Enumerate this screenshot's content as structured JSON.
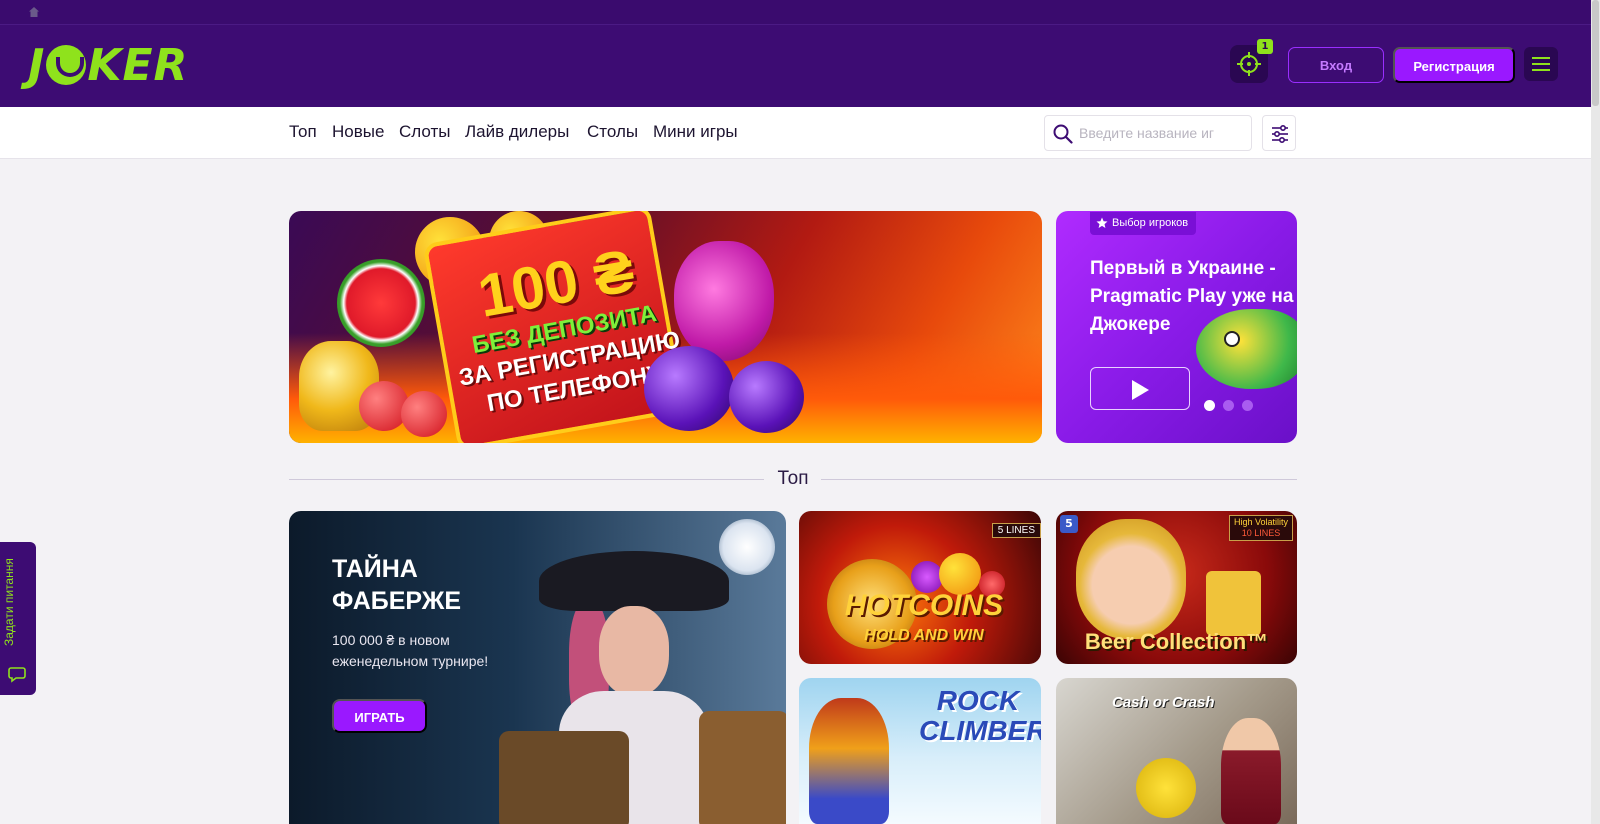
{
  "topbar": {
    "home_icon": "home-icon"
  },
  "header": {
    "logo_text_a": "J",
    "logo_text_b": "KER",
    "notification_count": "1",
    "login_label": "Вход",
    "register_label": "Регистрация",
    "menu_icon": "hamburger-menu-icon",
    "target_icon": "crosshair-icon",
    "brand_color": "#8fe21c",
    "header_bg": "#3d0c73",
    "accent": "#9a18ff"
  },
  "nav": {
    "items": [
      {
        "label": "Топ"
      },
      {
        "label": "Новые"
      },
      {
        "label": "Слоты"
      },
      {
        "label": "Лайв дилеры"
      },
      {
        "label": "Столы"
      },
      {
        "label": "Мини игры"
      }
    ],
    "search_placeholder": "Введите название иг",
    "filter_icon": "sliders-icon"
  },
  "banner_main": {
    "amount": "100 ₴",
    "line1": "БЕЗ ДЕПОЗИТА",
    "line2": "ЗА РЕГИСТРАЦИЮ",
    "line3": "ПО ТЕЛЕФОНУ"
  },
  "banner_side": {
    "badge": "Выбор игроков",
    "title": "Первый в Украине - Pragmatic Play уже на Джокере",
    "slide_count": 3,
    "active_slide": 1
  },
  "section": {
    "title": "Топ"
  },
  "featured": {
    "title": "ТАЙНА ФАБЕРЖЕ",
    "subtitle": "100 000 ₴ в новом еженедельном турнире!",
    "button": "ИГРАТЬ"
  },
  "games": {
    "hot_coins": {
      "title": "HOTCOINS",
      "subtitle": "HOLD AND WIN",
      "lines": "5 LINES"
    },
    "beer_collection": {
      "title": "Beer Collection™",
      "badge_top": "High Volatility",
      "badge_lines": "10 LINES",
      "provider_mark": "5"
    },
    "rock_climber": {
      "title": "ROCK CLIMBER"
    },
    "cash_or_crash": {
      "title": "Cash or Crash"
    }
  },
  "feedback": {
    "label": "Задати питання"
  }
}
